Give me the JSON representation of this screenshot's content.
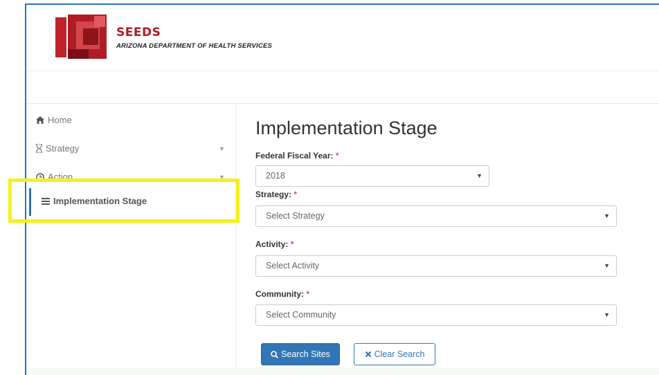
{
  "header": {
    "brand_name": "SEEDS",
    "brand_subtitle": "ARIZONA DEPARTMENT OF HEALTH SERVICES"
  },
  "sidebar": {
    "items": [
      {
        "label": "Home",
        "icon": "home-icon"
      },
      {
        "label": "Strategy",
        "icon": "hourglass-icon",
        "has_caret": true
      },
      {
        "label": "Action",
        "icon": "clock-icon",
        "has_caret": true
      },
      {
        "label": "Implementation Stage",
        "icon": "list-icon",
        "active": true
      }
    ]
  },
  "main": {
    "title": "Implementation Stage",
    "fiscal_year": {
      "label": "Federal Fiscal Year:",
      "required": "*",
      "value": "2018"
    },
    "strategy": {
      "label": "Strategy:",
      "required": "*",
      "placeholder": "Select Strategy"
    },
    "activity": {
      "label": "Activity:",
      "required": "*",
      "placeholder": "Select Activity"
    },
    "community": {
      "label": "Community:",
      "required": "*",
      "placeholder": "Select Community"
    },
    "search_button": "Search Sites",
    "clear_button": "Clear Search"
  },
  "colors": {
    "accent": "#3176b5",
    "brand_red": "#b01c26",
    "highlight": "#f4f11a",
    "required": "#d9534f"
  }
}
